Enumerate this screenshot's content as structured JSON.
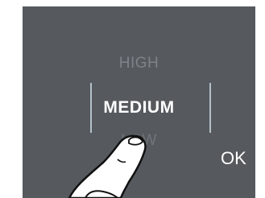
{
  "selector": {
    "options": [
      "HIGH",
      "MEDIUM",
      "LOW"
    ],
    "selected": "MEDIUM"
  },
  "ok_label": "OK",
  "colors": {
    "background": "#565a5e",
    "selected_text": "#ffffff",
    "unselected_text": "#7d838a",
    "bracket": "#b4c0c8"
  },
  "icons": {
    "pointer": "hand-pointer-icon"
  }
}
